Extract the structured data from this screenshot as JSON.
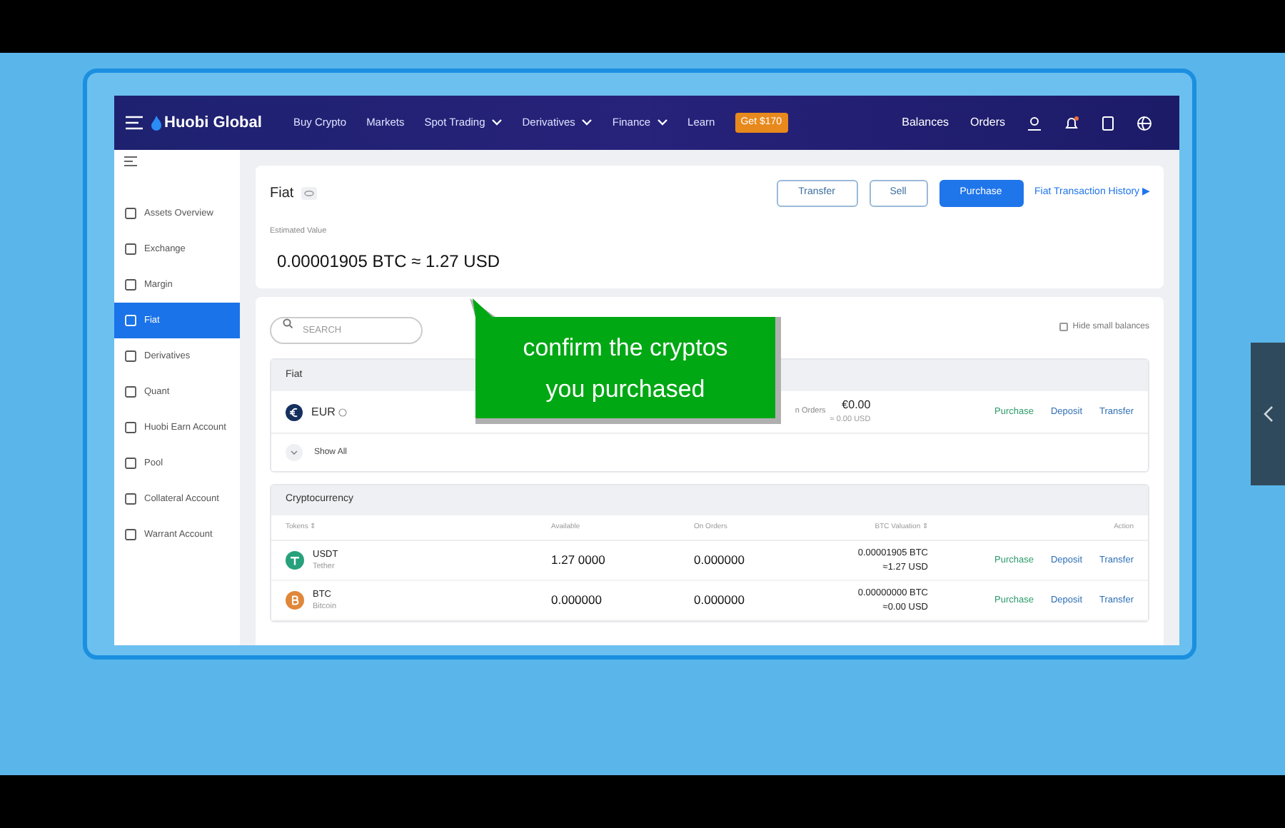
{
  "nav": {
    "logo": "Huobi Global",
    "items": [
      {
        "label": "Buy Crypto",
        "dropdown": false
      },
      {
        "label": "Markets",
        "dropdown": false
      },
      {
        "label": "Spot Trading",
        "dropdown": true
      },
      {
        "label": "Derivatives",
        "dropdown": true
      },
      {
        "label": "Finance",
        "dropdown": true
      },
      {
        "label": "Learn",
        "dropdown": false
      }
    ],
    "promo": "Get $170",
    "right": [
      "Balances",
      "Orders"
    ]
  },
  "sidebar": {
    "items": [
      {
        "label": "Assets Overview",
        "selected": false
      },
      {
        "label": "Exchange",
        "selected": false
      },
      {
        "label": "Margin",
        "selected": false
      },
      {
        "label": "Fiat",
        "selected": true
      },
      {
        "label": "Derivatives",
        "selected": false
      },
      {
        "label": "Quant",
        "selected": false
      },
      {
        "label": "Huobi Earn Account",
        "selected": false
      },
      {
        "label": "Pool",
        "selected": false
      },
      {
        "label": "Collateral Account",
        "selected": false
      },
      {
        "label": "Warrant Account",
        "selected": false
      }
    ]
  },
  "summary": {
    "title": "Fiat",
    "buttons": [
      {
        "label": "Transfer",
        "kind": "outline"
      },
      {
        "label": "Sell",
        "kind": "outline"
      },
      {
        "label": "Purchase",
        "kind": "primary"
      }
    ],
    "history_link": "Fiat Transaction History ▶",
    "estimated_label": "Estimated Value",
    "estimated_value": "0.00001905 BTC ≈ 1.27 USD"
  },
  "search": {
    "placeholder": "SEARCH"
  },
  "hide_small_balances": {
    "label": "Hide small balances",
    "checked": false
  },
  "fiat_section": {
    "title": "Fiat",
    "row": {
      "currency": "EUR",
      "orders_label": "n Orders",
      "amount": "€0.00",
      "usd": "≈ 0.00 USD",
      "actions": [
        {
          "label": "Purchase",
          "color": "#2e9b6a"
        },
        {
          "label": "Deposit",
          "color": "#2f6fb3"
        },
        {
          "label": "Transfer",
          "color": "#2f6fb3"
        }
      ]
    },
    "show_all": "Show All"
  },
  "crypto_section": {
    "title": "Cryptocurrency",
    "columns": [
      "Tokens ⇕",
      "Available",
      "On Orders",
      "BTC Valuation ⇕",
      "Action"
    ],
    "rows": [
      {
        "symbol": "USDT",
        "name": "Tether",
        "color": "#26a17b",
        "available": "1.27 0000",
        "on_orders": "0.000000",
        "btc": "0.00001905 BTC",
        "usd": "≈1.27 USD",
        "actions": [
          {
            "label": "Purchase",
            "color": "#2e9b6a"
          },
          {
            "label": "Deposit",
            "color": "#2f6fb3"
          },
          {
            "label": "Transfer",
            "color": "#2f6fb3"
          }
        ]
      },
      {
        "symbol": "BTC",
        "name": "Bitcoin",
        "color": "#e0873a",
        "available": "0.000000",
        "on_orders": "0.000000",
        "btc": "0.00000000 BTC",
        "usd": "≈0.00 USD",
        "actions": [
          {
            "label": "Purchase",
            "color": "#2e9b6a"
          },
          {
            "label": "Deposit",
            "color": "#2f6fb3"
          },
          {
            "label": "Transfer",
            "color": "#2f6fb3"
          }
        ]
      }
    ]
  },
  "callout": {
    "lines": [
      "confirm the cryptos",
      "you purchased"
    ]
  }
}
